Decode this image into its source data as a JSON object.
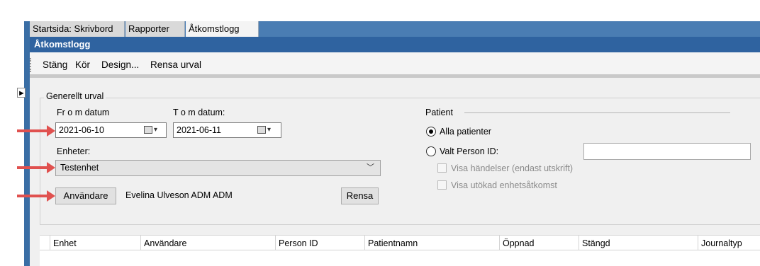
{
  "tabs": [
    {
      "label": "Startsida: Skrivbord"
    },
    {
      "label": "Rapporter"
    },
    {
      "label": "Åtkomstlogg"
    }
  ],
  "window_title": "Åtkomstlogg",
  "toolbar": {
    "close_label": "Stäng",
    "run_label": "Kör",
    "design_label": "Design...",
    "clear_label": "Rensa urval"
  },
  "general": {
    "legend": "Generellt urval",
    "from_label": "Fr o m datum",
    "to_label": "T o m datum:",
    "from_value": "2021-06-10",
    "to_value": "2021-06-11",
    "units_label": "Enheter:",
    "units_value": "Testenhet",
    "users_button": "Användare",
    "users_value": "Evelina Ulveson ADM ADM",
    "reset_button": "Rensa"
  },
  "patient": {
    "legend": "Patient",
    "all_label": "Alla patienter",
    "selected_label": "Valt Person ID:",
    "pid_value": "",
    "show_events_label": "Visa händelser (endast utskrift)",
    "show_extended_label": "Visa utökad enhetsåtkomst"
  },
  "table": {
    "columns": [
      "Enhet",
      "Användare",
      "Person ID",
      "Patientnamn",
      "Öppnad",
      "Stängd",
      "Journaltyp"
    ]
  },
  "icons": {
    "splitter": "arrow-right-icon",
    "calendar": "calendar-icon",
    "dropdown": "chevron-down-icon",
    "annotation": "red-arrow-icon"
  },
  "colors": {
    "tab_strip": "#4a7db3",
    "title_bar": "#2f63a0",
    "annotation_arrow": "#e0514f"
  }
}
